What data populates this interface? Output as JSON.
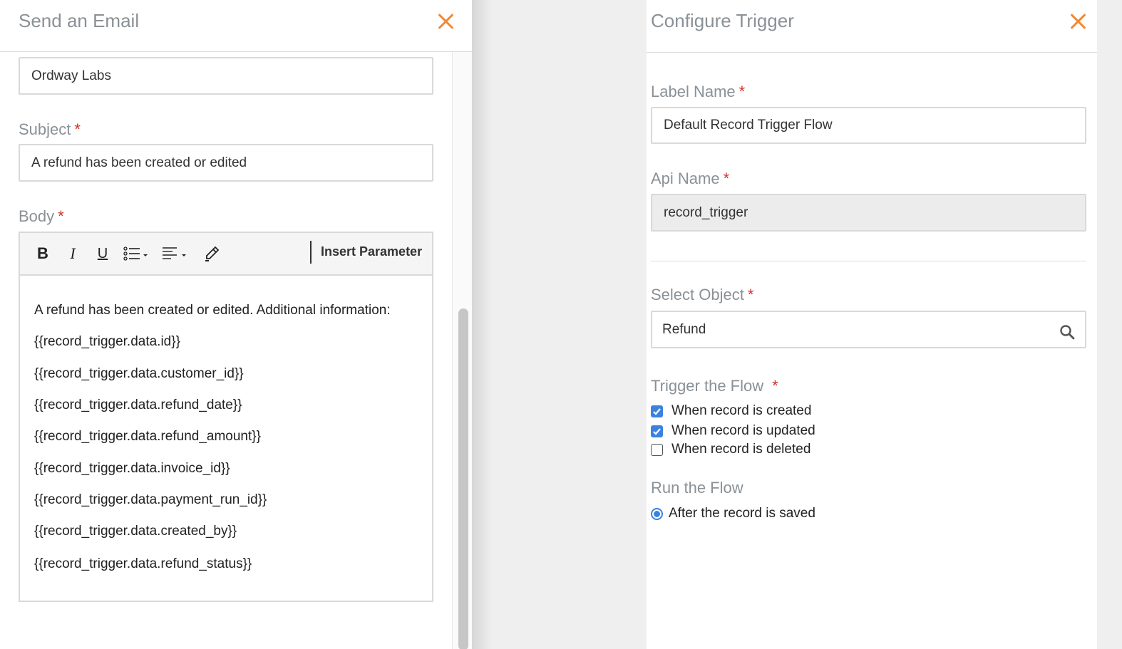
{
  "email_panel": {
    "title": "Send an Email",
    "from_value": "Ordway Labs",
    "subject": {
      "label": "Subject",
      "value": "A refund has been created or edited"
    },
    "body": {
      "label": "Body",
      "toolbar": {
        "bold": "B",
        "italic": "I",
        "underline": "U",
        "insert_parameter": "Insert Parameter"
      },
      "lines": [
        "A refund has been created or edited.  Additional information:",
        "{{record_trigger.data.id}}",
        "{{record_trigger.data.customer_id}}",
        "{{record_trigger.data.refund_date}}",
        "{{record_trigger.data.refund_amount}}",
        "{{record_trigger.data.invoice_id}}",
        "{{record_trigger.data.payment_run_id}}",
        "{{record_trigger.data.created_by}}",
        "{{record_trigger.data.refund_status}}"
      ]
    },
    "required_marker": "*"
  },
  "trigger_panel": {
    "title": "Configure Trigger",
    "label_name": {
      "label": "Label Name",
      "value": "Default Record Trigger Flow"
    },
    "api_name": {
      "label": "Api Name",
      "value": "record_trigger"
    },
    "select_object": {
      "label": "Select Object",
      "value": "Refund"
    },
    "trigger_flow": {
      "label": "Trigger the Flow",
      "options": [
        {
          "label": "When record is created",
          "checked": true
        },
        {
          "label": "When record is updated",
          "checked": true
        },
        {
          "label": "When record is deleted",
          "checked": false
        }
      ]
    },
    "run_flow": {
      "label": "Run the Flow",
      "option": "After the record is saved"
    }
  },
  "colors": {
    "accent_close": "#f08a34",
    "required": "#d0342c",
    "checkbox": "#3b82e0",
    "label": "#8a9196"
  }
}
